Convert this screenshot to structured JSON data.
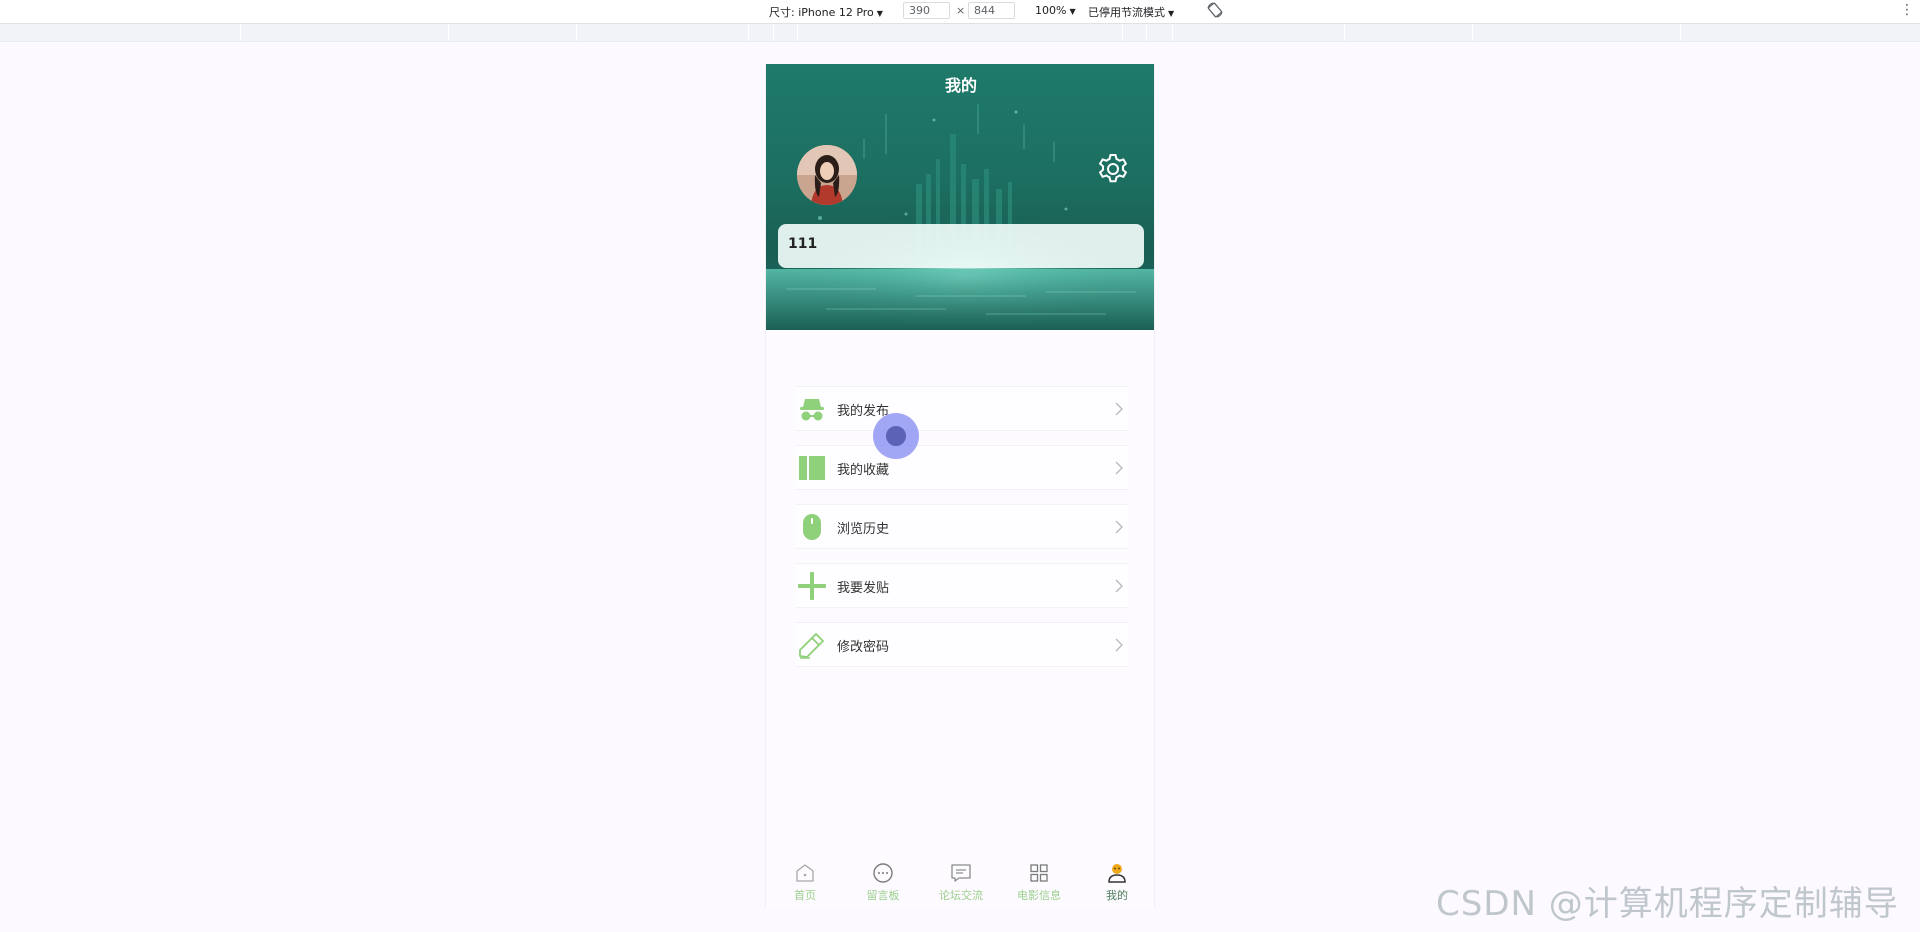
{
  "devtools": {
    "device_label": "尺寸: iPhone 12 Pro",
    "width": "390",
    "height": "844",
    "times": "×",
    "zoom": "100%",
    "throttle": "已停用节流模式",
    "more": "⋮"
  },
  "header": {
    "title": "我的",
    "username": "111"
  },
  "menu": {
    "items": [
      {
        "label": "我的发布",
        "icon": "incognito-icon"
      },
      {
        "label": "我的收藏",
        "icon": "collection-icon"
      },
      {
        "label": "浏览历史",
        "icon": "mouse-icon"
      },
      {
        "label": "我要发贴",
        "icon": "plus-icon"
      },
      {
        "label": "修改密码",
        "icon": "pencil-icon"
      }
    ]
  },
  "tabbar": {
    "tabs": [
      {
        "label": "首页",
        "icon": "home-icon"
      },
      {
        "label": "留言板",
        "icon": "chat-icon"
      },
      {
        "label": "论坛交流",
        "icon": "forum-icon"
      },
      {
        "label": "电影信息",
        "icon": "grid-icon"
      },
      {
        "label": "我的",
        "icon": "user-icon",
        "active": true
      }
    ]
  },
  "watermark": "CSDN @计算机程序定制辅导",
  "colors": {
    "hero": "#1f7a6a",
    "icon_green": "#8fd07a",
    "tab_label": "#9ccf8e",
    "active_tab": "#4d7b5c",
    "active_icon": "#f0a81c"
  }
}
